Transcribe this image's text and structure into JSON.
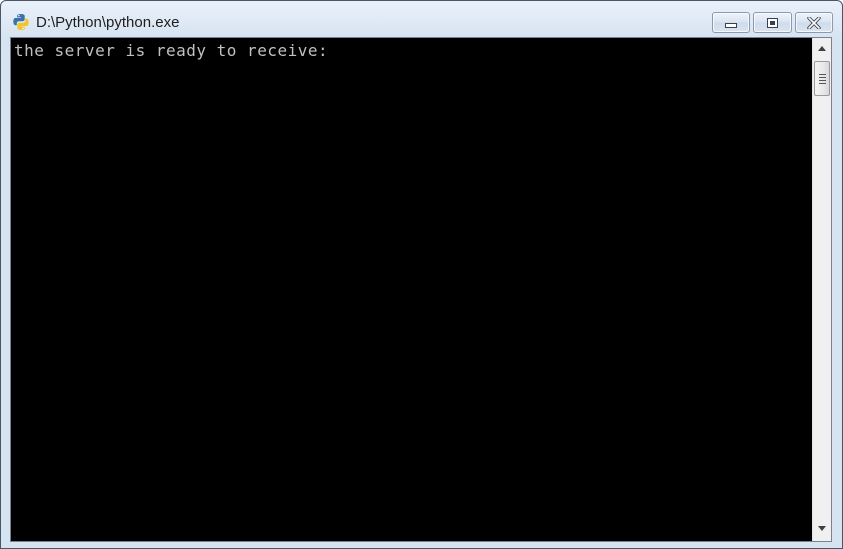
{
  "window": {
    "title": "D:\\Python\\python.exe",
    "icon": "python-icon",
    "controls": {
      "minimize": "minimize-icon",
      "maximize": "maximize-icon",
      "close": "close-icon"
    }
  },
  "console": {
    "lines": [
      "the server is ready to receive:"
    ],
    "background": "#000000",
    "text_color": "#c0c0c0"
  },
  "scrollbar": {
    "up_icon": "arrow-up-icon",
    "down_icon": "arrow-down-icon",
    "position": 0
  }
}
